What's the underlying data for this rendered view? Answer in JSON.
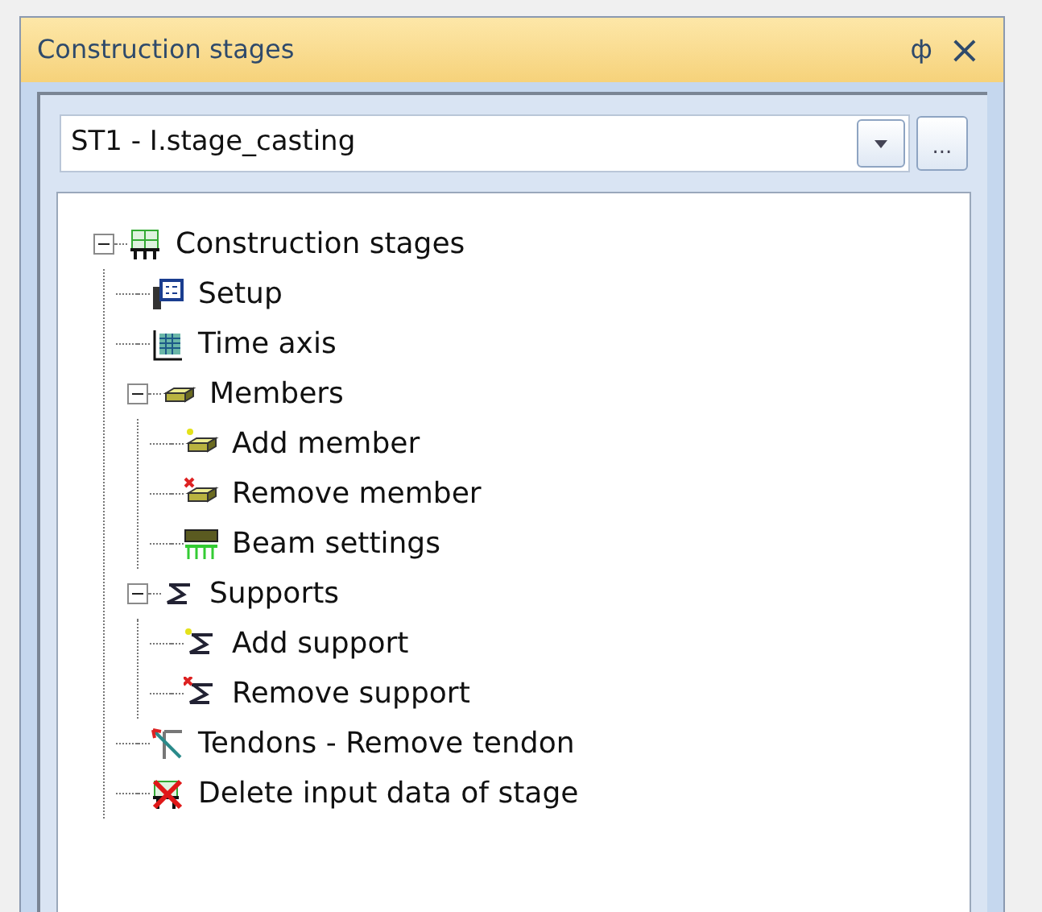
{
  "panel": {
    "title": "Construction stages",
    "pin_label": "ф",
    "close_label": "×"
  },
  "stage_select": {
    "value": "ST1 - I.stage_casting",
    "more_label": "..."
  },
  "tree": [
    {
      "label": "Construction stages",
      "kind": "stages",
      "expanded": true,
      "children": [
        {
          "label": "Setup",
          "kind": "setup"
        },
        {
          "label": "Time axis",
          "kind": "time"
        },
        {
          "label": "Members",
          "kind": "member",
          "expanded": true,
          "children": [
            {
              "label": "Add member",
              "kind": "member-add"
            },
            {
              "label": "Remove member",
              "kind": "member-remove"
            },
            {
              "label": "Beam settings",
              "kind": "beam"
            }
          ]
        },
        {
          "label": "Supports",
          "kind": "support",
          "expanded": true,
          "children": [
            {
              "label": "Add support",
              "kind": "support-add"
            },
            {
              "label": "Remove support",
              "kind": "support-remove"
            }
          ]
        },
        {
          "label": "Tendons - Remove tendon",
          "kind": "tendon"
        },
        {
          "label": "Delete input data of stage",
          "kind": "delete"
        }
      ]
    }
  ]
}
